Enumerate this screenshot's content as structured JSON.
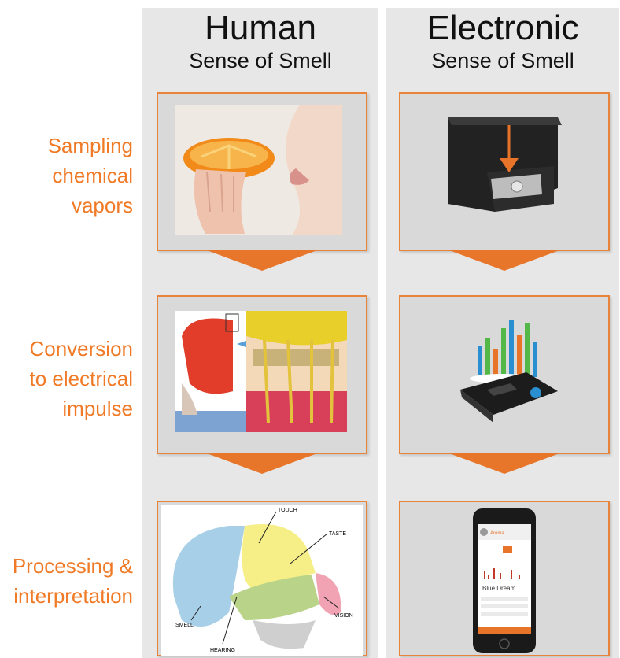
{
  "columns": {
    "human": {
      "title": "Human",
      "subtitle": "Sense of Smell"
    },
    "electronic": {
      "title": "Electronic",
      "subtitle": "Sense of Smell"
    }
  },
  "stages": [
    {
      "label": "Sampling\nchemical\nvapors"
    },
    {
      "label": "Conversion\nto electrical\nimpulse"
    },
    {
      "label": "Processing &\ninterpretation"
    }
  ],
  "brain_labels": {
    "touch": "TOUCH",
    "taste": "TASTE",
    "vision": "VISION",
    "smell": "SMELL",
    "hearing": "HEARING"
  },
  "phone_screen": {
    "header": "Aroma",
    "result": "Blue Dream"
  },
  "colors": {
    "accent": "#f07a26",
    "panel_border": "#e8843a",
    "column_bg": "#e7e7e7"
  }
}
